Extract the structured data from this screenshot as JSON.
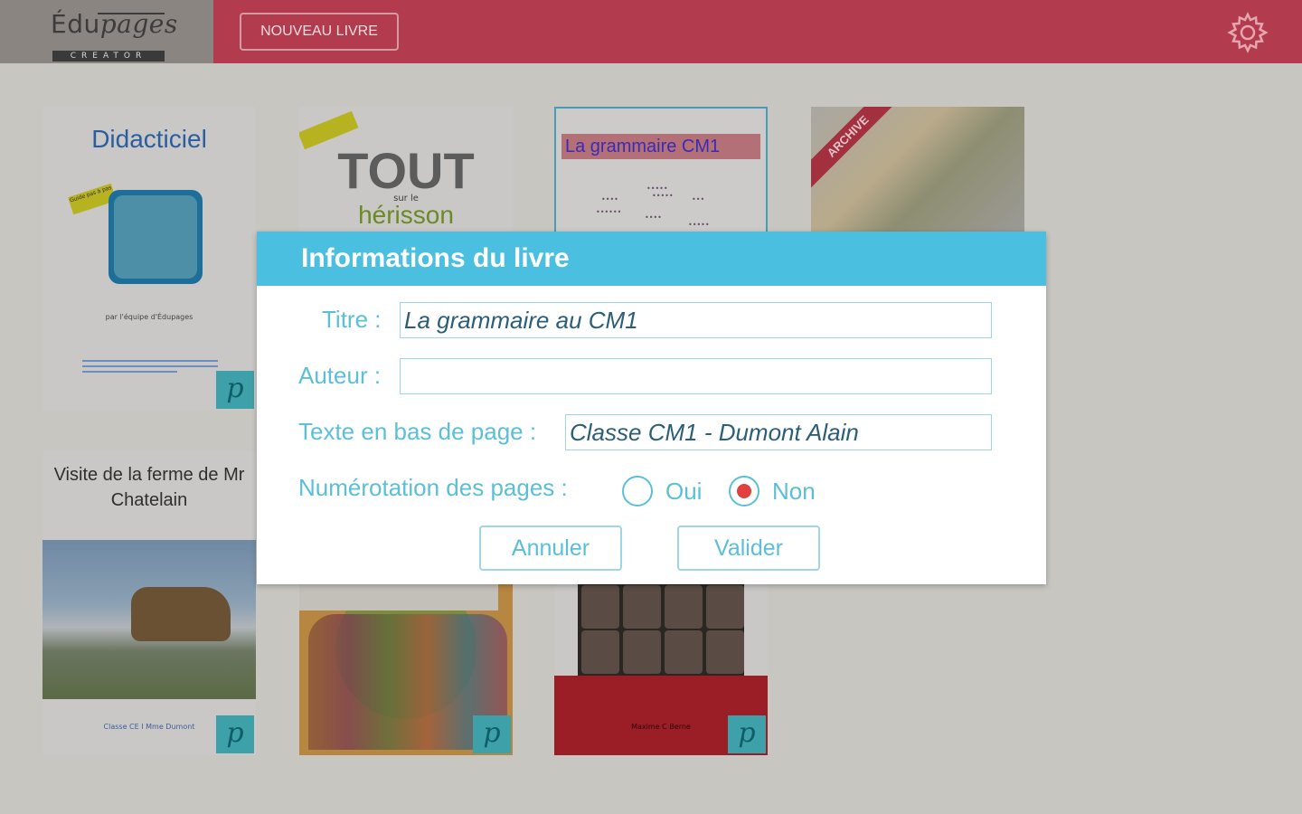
{
  "app": {
    "logo_main": "Édu",
    "logo_italic": "pages",
    "logo_sub": "CREATOR",
    "new_book_button": "NOUVEAU LIVRE",
    "settings_icon": "gear-icon"
  },
  "books": [
    {
      "title": "Didacticiel",
      "sticker": "Guide pas à pas",
      "byline": "par l'équipe d'Édupages",
      "badge": "p"
    },
    {
      "title": "TOUT",
      "connector": "sur le",
      "subtitle": "hérisson",
      "badge": ""
    },
    {
      "title": "La grammaire CM1",
      "badge": ""
    },
    {
      "ribbon": "ARCHIVE",
      "badge": ""
    },
    {
      "title": "Visite de la ferme de Mr Chatelain",
      "footer": "Classe CE I Mme Dumont",
      "badge": "p"
    },
    {
      "title": "",
      "badge": "p"
    },
    {
      "footer": "Maxime C Berne",
      "badge": "p"
    }
  ],
  "dialog": {
    "title": "Informations du livre",
    "titre_label": "Titre :",
    "titre_value": "La grammaire au CM1",
    "auteur_label": "Auteur :",
    "auteur_value": "",
    "footer_label": "Texte en bas de page :",
    "footer_value": "Classe CM1 - Dumont Alain",
    "numbering_label": "Numérotation des pages :",
    "option_yes": "Oui",
    "option_no": "Non",
    "selected": "Non",
    "cancel": "Annuler",
    "confirm": "Valider"
  },
  "colors": {
    "topbar": "#b23c4e",
    "dialog_header": "#4bbfe0",
    "accent_text": "#5cbfd8",
    "radio_selected": "#e1403f"
  }
}
